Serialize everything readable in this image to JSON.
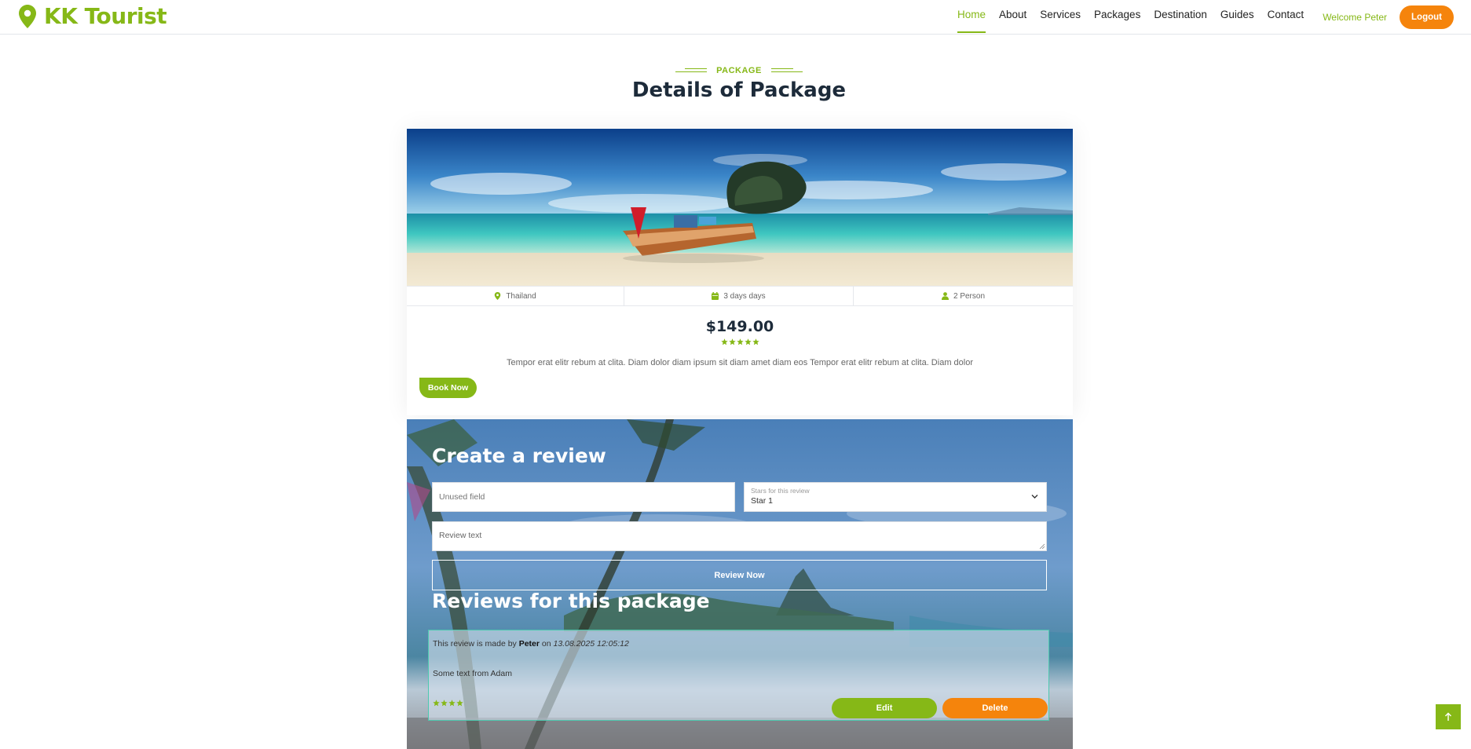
{
  "brand": {
    "name": "KK Tourist",
    "icon": "map-pin-icon"
  },
  "nav": {
    "items": [
      {
        "label": "Home",
        "active": true
      },
      {
        "label": "About",
        "active": false
      },
      {
        "label": "Services",
        "active": false
      },
      {
        "label": "Packages",
        "active": false
      },
      {
        "label": "Destination",
        "active": false
      },
      {
        "label": "Guides",
        "active": false
      },
      {
        "label": "Contact",
        "active": false
      }
    ],
    "welcome": "Welcome Peter",
    "logout_label": "Logout"
  },
  "section": {
    "label": "PACKAGE",
    "title": "Details of Package"
  },
  "package": {
    "location": "Thailand",
    "duration": "3 days days",
    "persons": "2 Person",
    "price": "$149.00",
    "rating": 5,
    "description": "Tempor erat elitr rebum at clita. Diam dolor diam ipsum sit diam amet diam eos Tempor erat elitr rebum at clita. Diam dolor",
    "book_label": "Book Now"
  },
  "review_form": {
    "title": "Create a review",
    "unused_placeholder": "Unused field",
    "stars_label": "Stars for this review",
    "stars_value": "Star 1",
    "text_placeholder": "Review text",
    "submit_label": "Review Now"
  },
  "reviews": {
    "title": "Reviews for this package",
    "items": [
      {
        "prefix": "This review is made by",
        "author": "Peter",
        "on": "on",
        "date": "13.08.2025 12:05:12",
        "text": "Some text from Adam",
        "rating": 4,
        "edit_label": "Edit",
        "delete_label": "Delete"
      }
    ]
  },
  "colors": {
    "accent": "#86b817",
    "orange": "#f5840c",
    "dark": "#1d2b3a"
  },
  "back_to_top_icon": "arrow-up-icon"
}
